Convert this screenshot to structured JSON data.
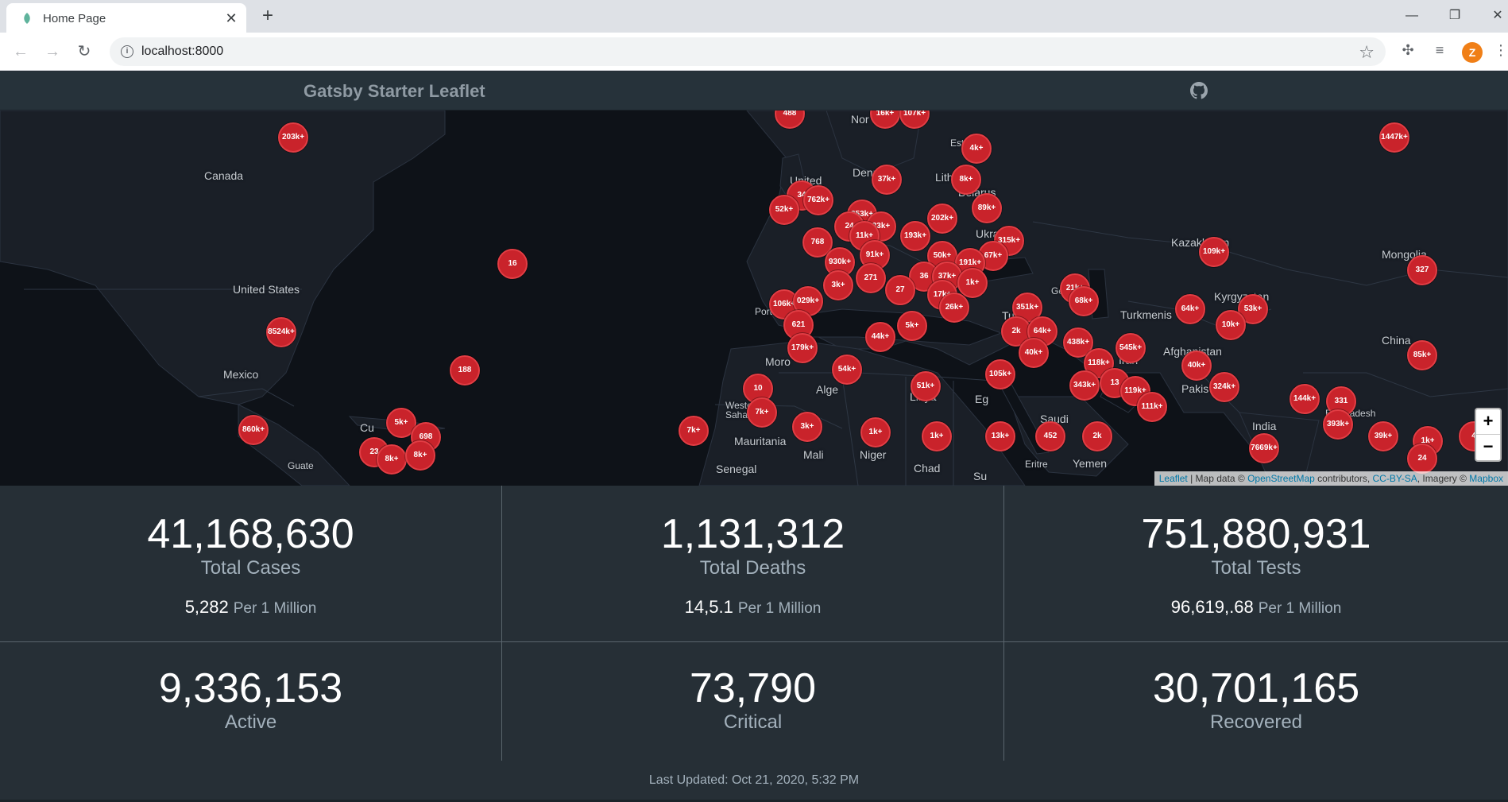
{
  "browser": {
    "tab_title": "Home Page",
    "url": "localhost:8000",
    "profile_initial": "Z"
  },
  "header": {
    "title": "Gatsby Starter Leaflet"
  },
  "map": {
    "labels": [
      "Canada",
      "United States",
      "Mexico",
      "United",
      "Denmark",
      "Lith",
      "Belarus",
      "Ukrai",
      "Kazakhstan",
      "Mongolia",
      "Kyrgyzstan",
      "Turkmenis",
      "Afghanistan",
      "Pakis",
      "China",
      "India",
      "Bangladesh",
      "Port",
      "Tur",
      "Moro",
      "Alge",
      "Libya",
      "Eg",
      "Saudi",
      "Iran",
      "Yemen",
      "Eritre",
      "Western Sahara",
      "Mauritania",
      "Mali",
      "Niger",
      "Chad",
      "Su",
      "Senegal",
      "Guate",
      "Cu",
      "Est",
      "Nor",
      "Ge"
    ],
    "markers": [
      "203k+",
      "16",
      "8524k+",
      "188",
      "860k+",
      "5k+",
      "698",
      "23",
      "8k+",
      "8k+",
      "488",
      "16k+",
      "107k+",
      "4k+",
      "8k+",
      "37k+",
      "34",
      "762k+",
      "52k+",
      "89k+",
      "202k+",
      "253k+",
      "24",
      "33k+",
      "11k+",
      "768",
      "193k+",
      "315k+",
      "930k+",
      "91k+",
      "50k+",
      "67k+",
      "191k+",
      "271",
      "3k+",
      "36",
      "37k+",
      "27",
      "17k+",
      "1k+",
      "26k+",
      "21k+",
      "68k+",
      "351k+",
      "106k+",
      "029k+",
      "621",
      "5k+",
      "179k+",
      "44k+",
      "2k",
      "64k+",
      "40k+",
      "438k+",
      "545k+",
      "118k+",
      "54k+",
      "105k+",
      "51k+",
      "343k+",
      "13",
      "119k+",
      "111k+",
      "10",
      "7k+",
      "3k+",
      "1k+",
      "1k+",
      "13k+",
      "452",
      "2k",
      "7k+",
      "109k+",
      "1447k+",
      "327",
      "64k+",
      "53k+",
      "10k+",
      "40k+",
      "324k+",
      "85k+",
      "144k+",
      "331",
      "393k+",
      "7669k+",
      "39k+",
      "1k+",
      "24",
      "4"
    ],
    "zoom_in": "+",
    "zoom_out": "−",
    "attribution": {
      "leaflet": "Leaflet",
      "mapdata": " | Map data © ",
      "osm": "OpenStreetMap",
      "contributors": " contributors, ",
      "ccbysa": "CC-BY-SA",
      "imagery": ", Imagery © ",
      "mapbox": "Mapbox"
    }
  },
  "stats": {
    "total_cases": {
      "value": "41,168,630",
      "label": "Total Cases",
      "per_million": "5,282",
      "unit": "Per 1 Million"
    },
    "total_deaths": {
      "value": "1,131,312",
      "label": "Total Deaths",
      "per_million": "14,5.1",
      "unit": "Per 1 Million"
    },
    "total_tests": {
      "value": "751,880,931",
      "label": "Total Tests",
      "per_million": "96,619,.68",
      "unit": "Per 1 Million"
    },
    "active": {
      "value": "9,336,153",
      "label": "Active"
    },
    "critical": {
      "value": "73,790",
      "label": "Critical"
    },
    "recovered": {
      "value": "30,701,165",
      "label": "Recovered"
    }
  },
  "footer": {
    "last_updated": "Last Updated: Oct 21, 2020, 5:32 PM"
  },
  "colors": {
    "marker": "#c9232b",
    "header_bg": "#26323a",
    "page_bg": "#262f36",
    "map_bg": "#0e1218"
  }
}
